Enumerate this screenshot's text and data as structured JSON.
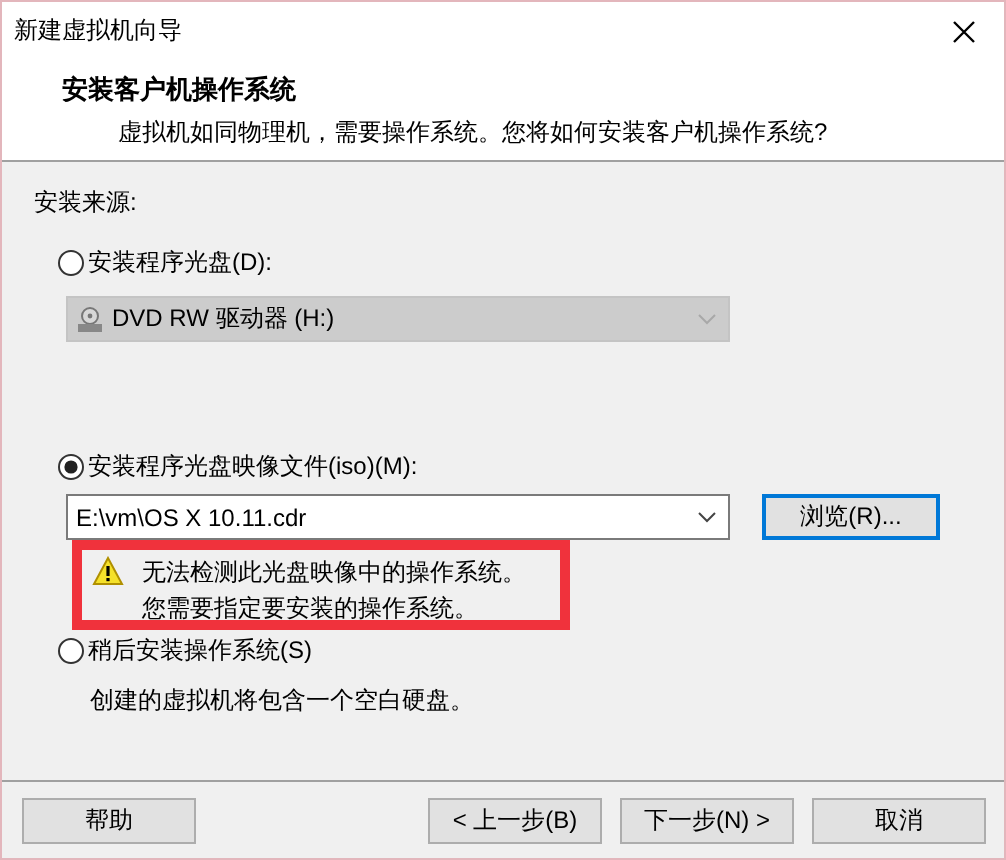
{
  "window": {
    "title": "新建虚拟机向导"
  },
  "header": {
    "title": "安装客户机操作系统",
    "subtitle": "虚拟机如同物理机，需要操作系统。您将如何安装客户机操作系统?"
  },
  "source_label": "安装来源:",
  "options": [
    {
      "kind": "disc",
      "label": "安装程序光盘(D):",
      "selected": false,
      "dropdown": {
        "value": "DVD RW 驱动器 (H:)",
        "disabled": true
      }
    },
    {
      "kind": "iso",
      "label": "安装程序光盘映像文件(iso)(M):",
      "selected": true,
      "dropdown": {
        "value": "E:\\vm\\OS X 10.11.cdr",
        "disabled": false
      },
      "browse_button": "浏览(R)...",
      "warning": [
        "无法检测此光盘映像中的操作系统。",
        "您需要指定要安装的操作系统。"
      ]
    },
    {
      "kind": "later",
      "label": "稍后安装操作系统(S)",
      "selected": false,
      "description": "创建的虚拟机将包含一个空白硬盘。"
    }
  ],
  "buttons": [
    "帮助",
    "< 上一步(B)",
    "下一步(N) >",
    "取消"
  ],
  "annotation": {
    "kind": "frame"
  }
}
